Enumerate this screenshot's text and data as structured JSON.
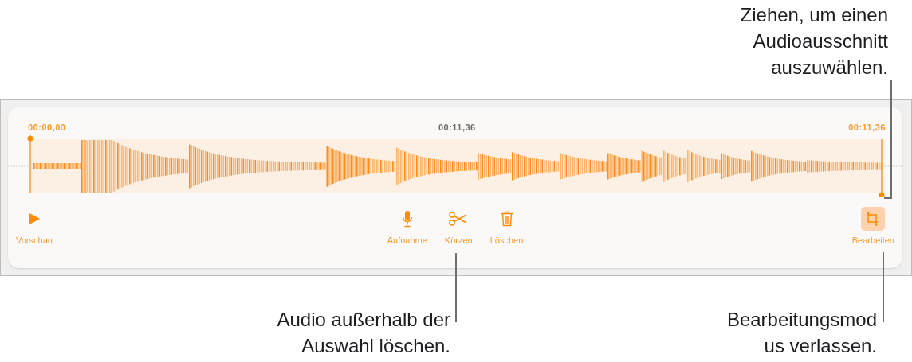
{
  "callouts": [
    {
      "lines": [
        "Ziehen, um einen",
        "Audioausschnitt",
        "auszuwählen."
      ]
    },
    {
      "lines": [
        "Audio außerhalb der",
        "Auswahl löschen."
      ]
    },
    {
      "lines": [
        "Bearbeitungsmod",
        "us verlassen."
      ]
    }
  ],
  "timeline": {
    "start": "00:00,00",
    "middle": "00:11,36",
    "end": "00:11,36"
  },
  "tools": [
    {
      "label": "Vorschau",
      "kind": "play",
      "selected": false
    },
    {
      "label": "Aufnahme",
      "kind": "mic",
      "selected": false
    },
    {
      "label": "Kürzen",
      "kind": "scissors",
      "selected": false
    },
    {
      "label": "Löschen",
      "kind": "trash",
      "selected": false
    },
    {
      "label": "Bearbeiten",
      "kind": "crop",
      "selected": true
    }
  ]
}
